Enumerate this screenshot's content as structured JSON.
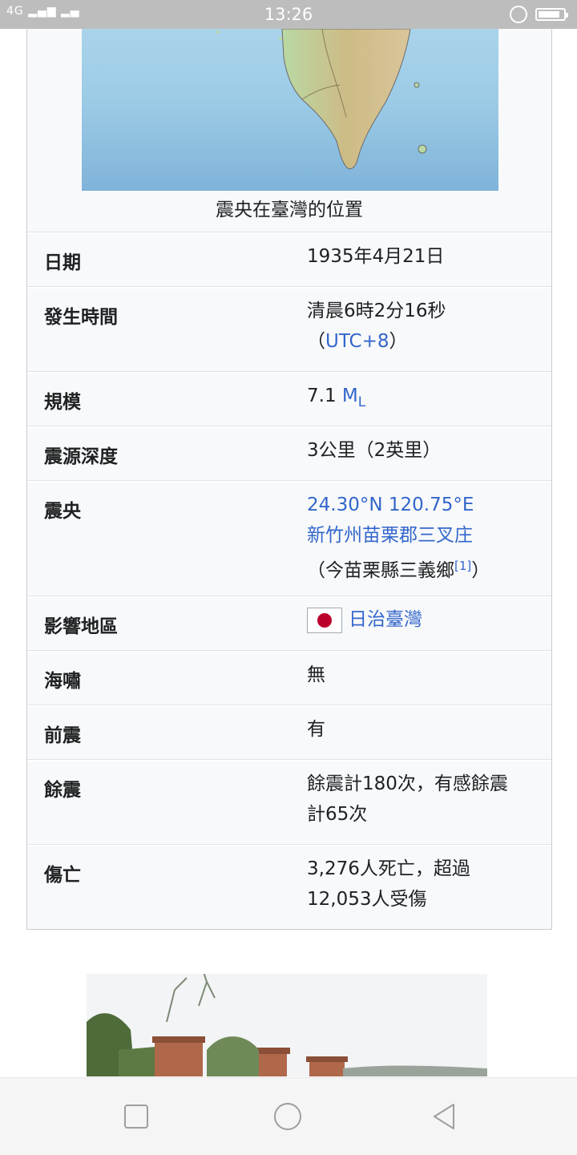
{
  "status_bar": {
    "network": "4G",
    "time": "13:26"
  },
  "infobox": {
    "map_caption": "震央在臺灣的位置",
    "rows": [
      {
        "label": "日期",
        "value": "1935年4月21日"
      },
      {
        "label": "發生時間",
        "value_line1": "清晨6時2分16秒",
        "value_paren_open": "（",
        "value_link": "UTC+8",
        "value_paren_close": "）"
      },
      {
        "label": "規模",
        "value_number": "7.1",
        "value_link": "M",
        "value_sub": "L"
      },
      {
        "label": "震源深度",
        "value": "3公里（2英里）"
      },
      {
        "label": "震央",
        "coords_link": "24.30°N 120.75°E",
        "place_link": "新竹州苗栗郡三叉庄",
        "note": "（今苗栗縣三義鄉",
        "ref": "[1]",
        "note_close": "）"
      },
      {
        "label": "影響地區",
        "value_link": "日治臺灣"
      },
      {
        "label": "海嘯",
        "value": "無"
      },
      {
        "label": "前震",
        "value": "有"
      },
      {
        "label": "餘震",
        "value_line1": "餘震計180次，有感餘震",
        "value_line2": "計65次"
      },
      {
        "label": "傷亡",
        "value_line1": "3,276人死亡，超過",
        "value_line2": "12,053人受傷"
      }
    ]
  },
  "colors": {
    "link": "#3366cc",
    "infobox_bg": "#f8f9fa",
    "flag_red": "#bc002d"
  }
}
